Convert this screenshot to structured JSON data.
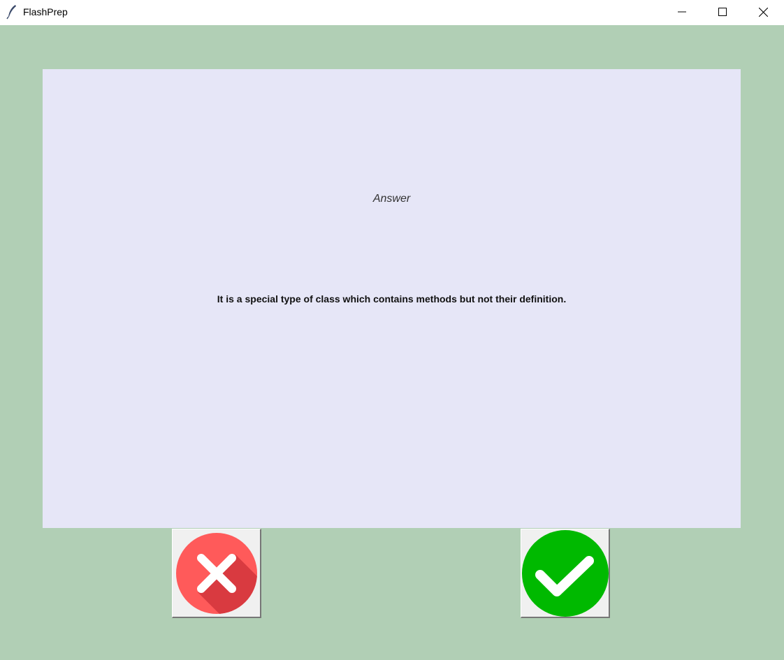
{
  "window": {
    "title": "FlashPrep",
    "icon": "feather-icon",
    "controls": [
      "minimize-icon",
      "maximize-icon",
      "close-icon"
    ]
  },
  "card": {
    "label": "Answer",
    "text": "It is a special type of class which contains methods but not their definition."
  },
  "actions": {
    "wrong": {
      "icon": "cross-icon",
      "color": "#ff5a5a"
    },
    "right": {
      "icon": "checkmark-icon",
      "color": "#00b900"
    }
  },
  "colors": {
    "background": "#b1cfb5",
    "card": "#e6e6f7"
  }
}
